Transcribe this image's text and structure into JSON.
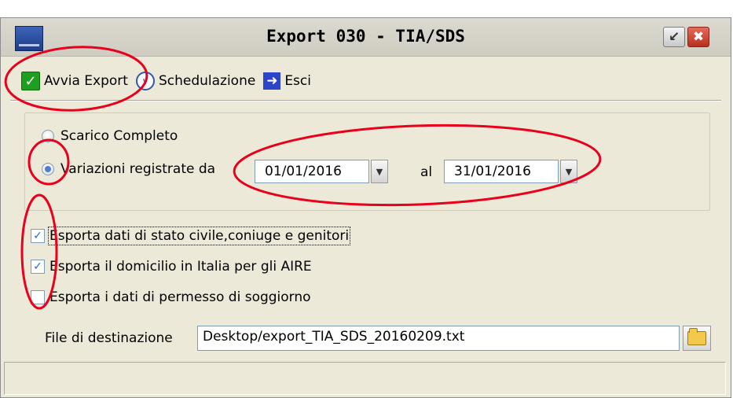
{
  "window": {
    "title": "Export 030 - TIA/SDS",
    "app_icon": "app-logo-icon",
    "controls": {
      "restore_icon": "restore-icon",
      "close_icon": "close-icon"
    }
  },
  "toolbar": {
    "start_export_label": "Avvia Export",
    "schedule_label": "Schedulazione",
    "exit_label": "Esci"
  },
  "options": {
    "full_download_label": "Scarico Completo",
    "changes_label": "Variazioni registrate da",
    "date_from": "01/01/2016",
    "to_label": "al",
    "date_to": "31/01/2016",
    "selected": "changes"
  },
  "checkboxes": [
    {
      "label": "Esporta dati di stato civile,coniuge e genitori",
      "checked": true
    },
    {
      "label": "Esporta il domicilio in Italia per gli AIRE",
      "checked": true
    },
    {
      "label": "Esporta i dati di permesso di soggiorno",
      "checked": false
    }
  ],
  "destination": {
    "label": "File di destinazione",
    "value": "Desktop/export_TIA_SDS_20160209.txt"
  },
  "colors": {
    "annotation_red": "#e8001c",
    "window_bg": "#ece9d8"
  }
}
